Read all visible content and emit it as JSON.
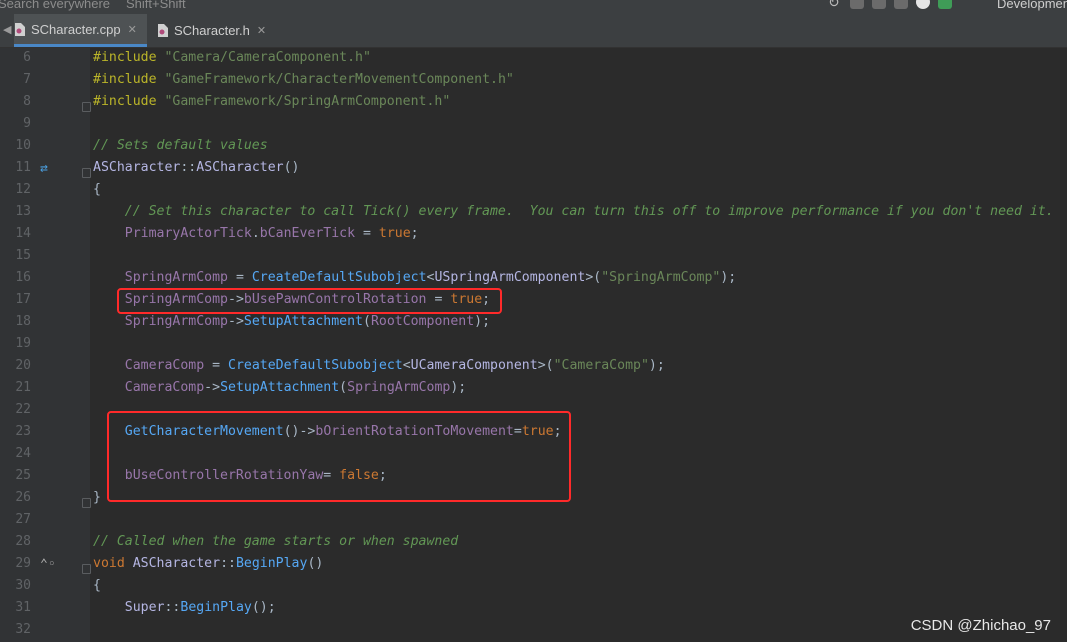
{
  "topbar": {
    "search_text": "Search everywhere",
    "search_shortcut": "Shift+Shift",
    "configuration": "Development"
  },
  "tabs": [
    {
      "label": "SCharacter.cpp",
      "close": "✕",
      "active": true
    },
    {
      "label": "SCharacter.h",
      "close": "✕",
      "active": false
    }
  ],
  "editor": {
    "lines": [
      {
        "n": "6",
        "text": "#include \"Camera/CameraComponent.h\""
      },
      {
        "n": "7",
        "text": "#include \"GameFramework/CharacterMovementComponent.h\""
      },
      {
        "n": "8",
        "text": "#include \"GameFramework/SpringArmComponent.h\""
      },
      {
        "n": "9",
        "text": ""
      },
      {
        "n": "10",
        "text": "// Sets default values"
      },
      {
        "n": "11",
        "text": "ASCharacter::ASCharacter()"
      },
      {
        "n": "12",
        "text": "{"
      },
      {
        "n": "13",
        "text": "    // Set this character to call Tick() every frame.  You can turn this off to improve performance if you don't need it."
      },
      {
        "n": "14",
        "text": "    PrimaryActorTick.bCanEverTick = true;"
      },
      {
        "n": "15",
        "text": ""
      },
      {
        "n": "16",
        "text": "    SpringArmComp = CreateDefaultSubobject<USpringArmComponent>(\"SpringArmComp\");"
      },
      {
        "n": "17",
        "text": "    SpringArmComp->bUsePawnControlRotation = true;"
      },
      {
        "n": "18",
        "text": "    SpringArmComp->SetupAttachment(RootComponent);"
      },
      {
        "n": "19",
        "text": ""
      },
      {
        "n": "20",
        "text": "    CameraComp = CreateDefaultSubobject<UCameraComponent>(\"CameraComp\");"
      },
      {
        "n": "21",
        "text": "    CameraComp->SetupAttachment(SpringArmComp);"
      },
      {
        "n": "22",
        "text": ""
      },
      {
        "n": "23",
        "text": "    GetCharacterMovement()->bOrientRotationToMovement=true;"
      },
      {
        "n": "24",
        "text": ""
      },
      {
        "n": "25",
        "text": "    bUseControllerRotationYaw= false;"
      },
      {
        "n": "26",
        "text": "}"
      },
      {
        "n": "27",
        "text": ""
      },
      {
        "n": "28",
        "text": "// Called when the game starts or when spawned"
      },
      {
        "n": "29",
        "text": "void ASCharacter::BeginPlay()"
      },
      {
        "n": "30",
        "text": "{"
      },
      {
        "n": "31",
        "text": "    Super::BeginPlay();"
      },
      {
        "n": "32",
        "text": ""
      }
    ]
  },
  "watermark": "CSDN @Zhichao_97",
  "colors": {
    "background": "#2b2b2b",
    "gutter": "#313335",
    "highlight_box": "#ff2a2a",
    "comment": "#629755",
    "string": "#6a8759",
    "keyword": "#cc7832",
    "preprocessor": "#bbb529"
  }
}
